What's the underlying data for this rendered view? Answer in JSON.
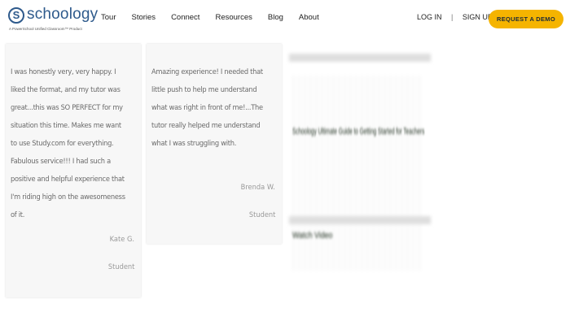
{
  "header": {
    "logo": {
      "mark": "S",
      "wordmark": "schoology",
      "tagline": "A PowerSchool Unified Classroom™ Product"
    },
    "nav": [
      "Tour",
      "Stories",
      "Connect",
      "Resources",
      "Blog",
      "About"
    ],
    "login_label": "LOG IN",
    "separator": "|",
    "signup_label": "SIGN UP",
    "demo_label": "REQUEST A DEMO"
  },
  "testimonials": [
    {
      "quote": "I was honestly very, very happy. I liked the format, and my tutor was great...this was SO PERFECT for my situation this time. Makes me want to use Study.com for everything. Fabulous service!!! I had such a positive and helpful experience that I'm riding high on the awesomeness of it.",
      "name": "Kate G.",
      "role": "Student"
    },
    {
      "quote": "Amazing experience! I needed that little push to help me understand what was right in front of me!...The tutor really helped me understand what I was struggling with.",
      "name": "Brenda W.",
      "role": "Student"
    }
  ],
  "media": {
    "line_1": "Schoology Ultimate Guide to Getting Started for Teachers",
    "line_2": "Watch Video"
  },
  "colors": {
    "brand_blue": "#2e5a8c",
    "demo_button": "#f5b400"
  }
}
